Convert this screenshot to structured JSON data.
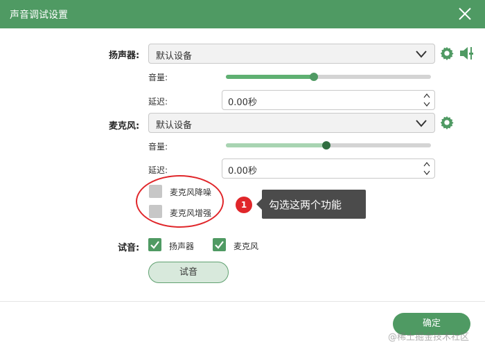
{
  "window": {
    "title": "声音调试设置"
  },
  "speaker": {
    "label": "扬声器:",
    "device": "默认设备",
    "volume_label": "音量:",
    "volume_level": 0.43,
    "delay_label": "延迟:",
    "delay_value": "0.00秒"
  },
  "microphone": {
    "label": "麦克风:",
    "device": "默认设备",
    "volume_label": "音量:",
    "volume_level": 0.49,
    "delay_label": "延迟:",
    "delay_value": "0.00秒",
    "noise_reduction_label": "麦克风降噪",
    "noise_reduction_checked": false,
    "enhance_label": "麦克风增强",
    "enhance_checked": false
  },
  "annotation": {
    "number": "1",
    "text": "勾选这两个功能"
  },
  "test": {
    "label": "试音:",
    "speaker_label": "扬声器",
    "speaker_checked": true,
    "mic_label": "麦克风",
    "mic_checked": true,
    "button_label": "试音"
  },
  "footer": {
    "ok_label": "确定"
  },
  "watermark": "@稀土掘金技术社区",
  "colors": {
    "accent": "#4f9a63",
    "annotation_red": "#e0262a"
  }
}
